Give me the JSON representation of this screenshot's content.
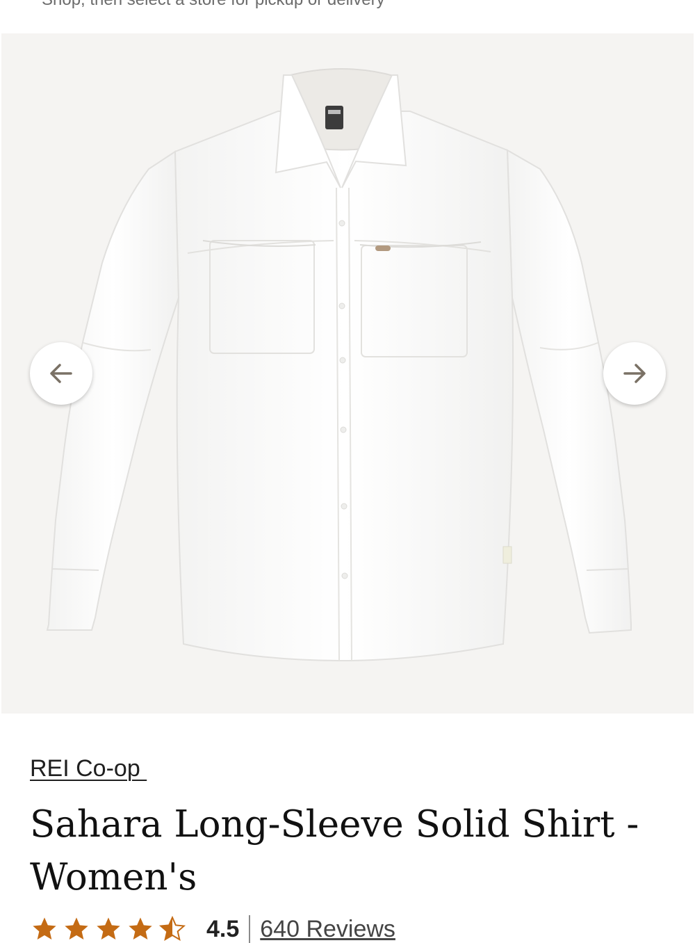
{
  "top_strip": {
    "text": "Shop, then select a store for pickup or delivery"
  },
  "gallery": {
    "prev_icon": "arrow-left-icon",
    "next_icon": "arrow-right-icon",
    "arrow_color": "#7a7165",
    "background_color": "#f5f4f2"
  },
  "product": {
    "brand": "REI Co-op ",
    "title": "Sahara Long-Sleeve Solid Shirt - Women's",
    "rating": {
      "value": "4.5",
      "stars": 4.5,
      "star_color": "#c46b14",
      "reviews_label": "640 Reviews"
    }
  }
}
